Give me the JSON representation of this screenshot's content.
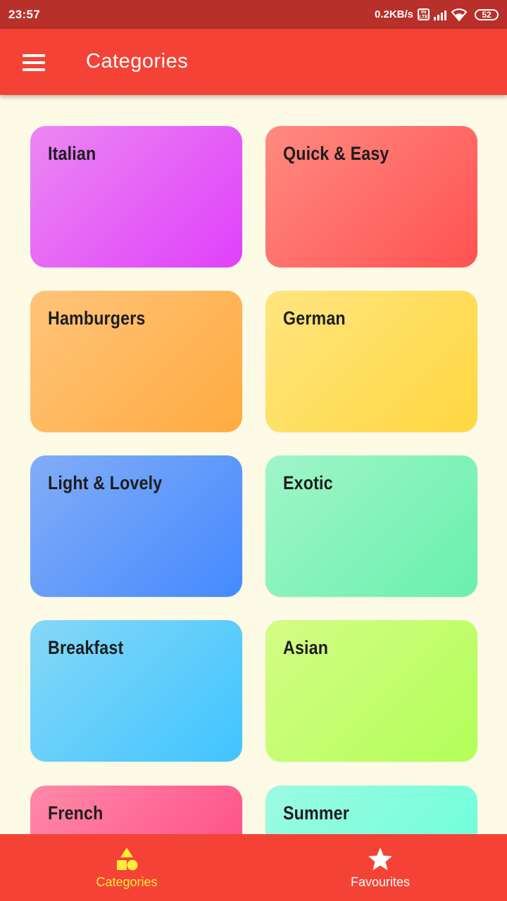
{
  "status_bar": {
    "time": "23:57",
    "network_speed": "0.2KB/s",
    "volte_label": "Vo LTE",
    "battery": "52"
  },
  "app_bar": {
    "title": "Categories",
    "menu_icon": "hamburger-menu-icon"
  },
  "categories": [
    {
      "label": "Italian",
      "color_from": "#eb88f2",
      "color_to": "#e040fb"
    },
    {
      "label": "Quick & Easy",
      "color_from": "#ff8a80",
      "color_to": "#ff5252"
    },
    {
      "label": "Hamburgers",
      "color_from": "#ffc47a",
      "color_to": "#ffab40"
    },
    {
      "label": "German",
      "color_from": "#ffe57f",
      "color_to": "#ffd740"
    },
    {
      "label": "Light & Lovely",
      "color_from": "#82adf6",
      "color_to": "#448aff"
    },
    {
      "label": "Exotic",
      "color_from": "#a0f5c8",
      "color_to": "#69f0ae"
    },
    {
      "label": "Breakfast",
      "color_from": "#85d8f7",
      "color_to": "#40c4ff"
    },
    {
      "label": "Asian",
      "color_from": "#d4fc85",
      "color_to": "#b2ff59"
    },
    {
      "label": "French",
      "color_from": "#ff8aa8",
      "color_to": "#ff4081"
    },
    {
      "label": "Summer",
      "color_from": "#9dfbe0",
      "color_to": "#64ffda"
    }
  ],
  "bottom_nav": {
    "items": [
      {
        "label": "Categories",
        "icon": "category-shapes-icon",
        "active": true,
        "color": "#ffeb3b"
      },
      {
        "label": "Favourites",
        "icon": "star-icon",
        "active": false,
        "color": "#ffffff"
      }
    ]
  },
  "colors": {
    "primary": "#f44336",
    "status_bar": "#b8302a",
    "background": "#fdfbe6",
    "accent": "#ffeb3b"
  }
}
